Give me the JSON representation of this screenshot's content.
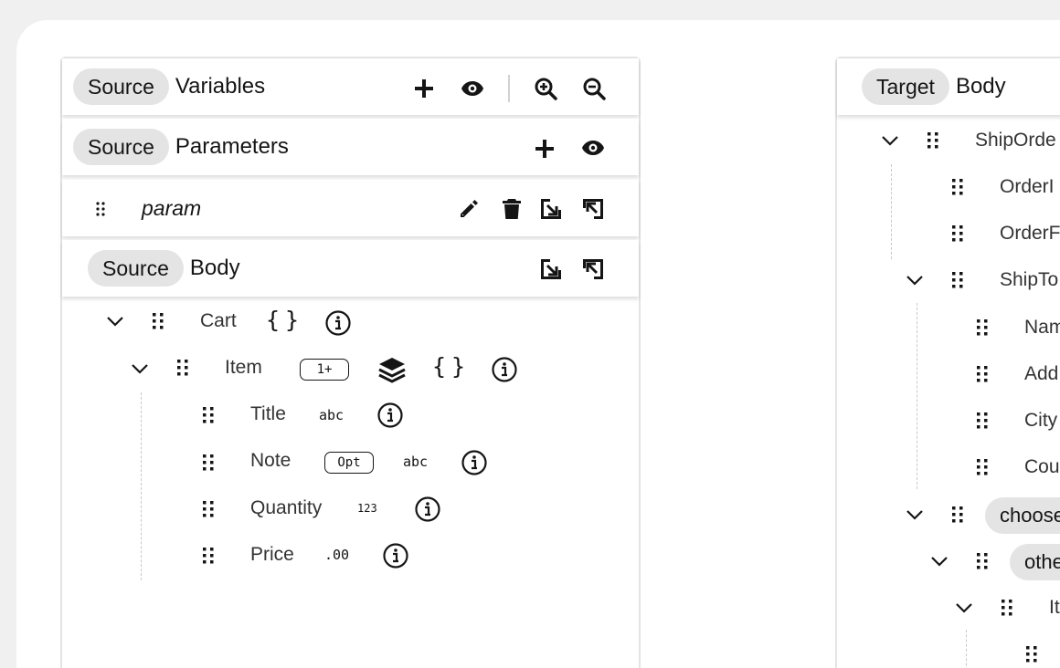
{
  "source": {
    "variables_header": {
      "tag": "Source",
      "title": "Variables"
    },
    "parameters_header": {
      "tag": "Source",
      "title": "Parameters"
    },
    "param_row": {
      "name": "param"
    },
    "body_header": {
      "tag": "Source",
      "title": "Body"
    },
    "tree": {
      "cart": {
        "label": "Cart",
        "braces": "{}"
      },
      "item": {
        "label": "Item",
        "badge": "1+",
        "braces": "{}"
      },
      "fields": [
        {
          "label": "Title",
          "badge": "",
          "type": "abc"
        },
        {
          "label": "Note",
          "badge": "Opt",
          "type": "abc"
        },
        {
          "label": "Quantity",
          "badge": "",
          "type": "123"
        },
        {
          "label": "Price",
          "badge": "",
          "type": ".00"
        }
      ]
    }
  },
  "target": {
    "header": {
      "tag": "Target",
      "title": "Body"
    },
    "tree": {
      "ship_order": "ShipOrde",
      "order_id": "OrderI",
      "order_person": "OrderF",
      "ship_to": "ShipTo",
      "name": "Nam",
      "address": "Add",
      "city": "City",
      "country": "Cou",
      "choose": "choose",
      "otherwise": "othe",
      "item": "It"
    }
  },
  "icons": {
    "add": "plus-icon",
    "view": "eye-icon",
    "zoom_in": "zoom-in-icon",
    "zoom_out": "zoom-out-icon",
    "edit": "pencil-icon",
    "delete": "trash-icon",
    "import": "import-icon",
    "export": "export-icon",
    "collection": "layers-icon",
    "info": "info-circle-icon",
    "drag": "drag-grip-icon",
    "expand": "chevron-down-icon"
  },
  "colors": {
    "background": "#f0f0f0",
    "pill": "#e4e4e4",
    "text": "#151515"
  }
}
